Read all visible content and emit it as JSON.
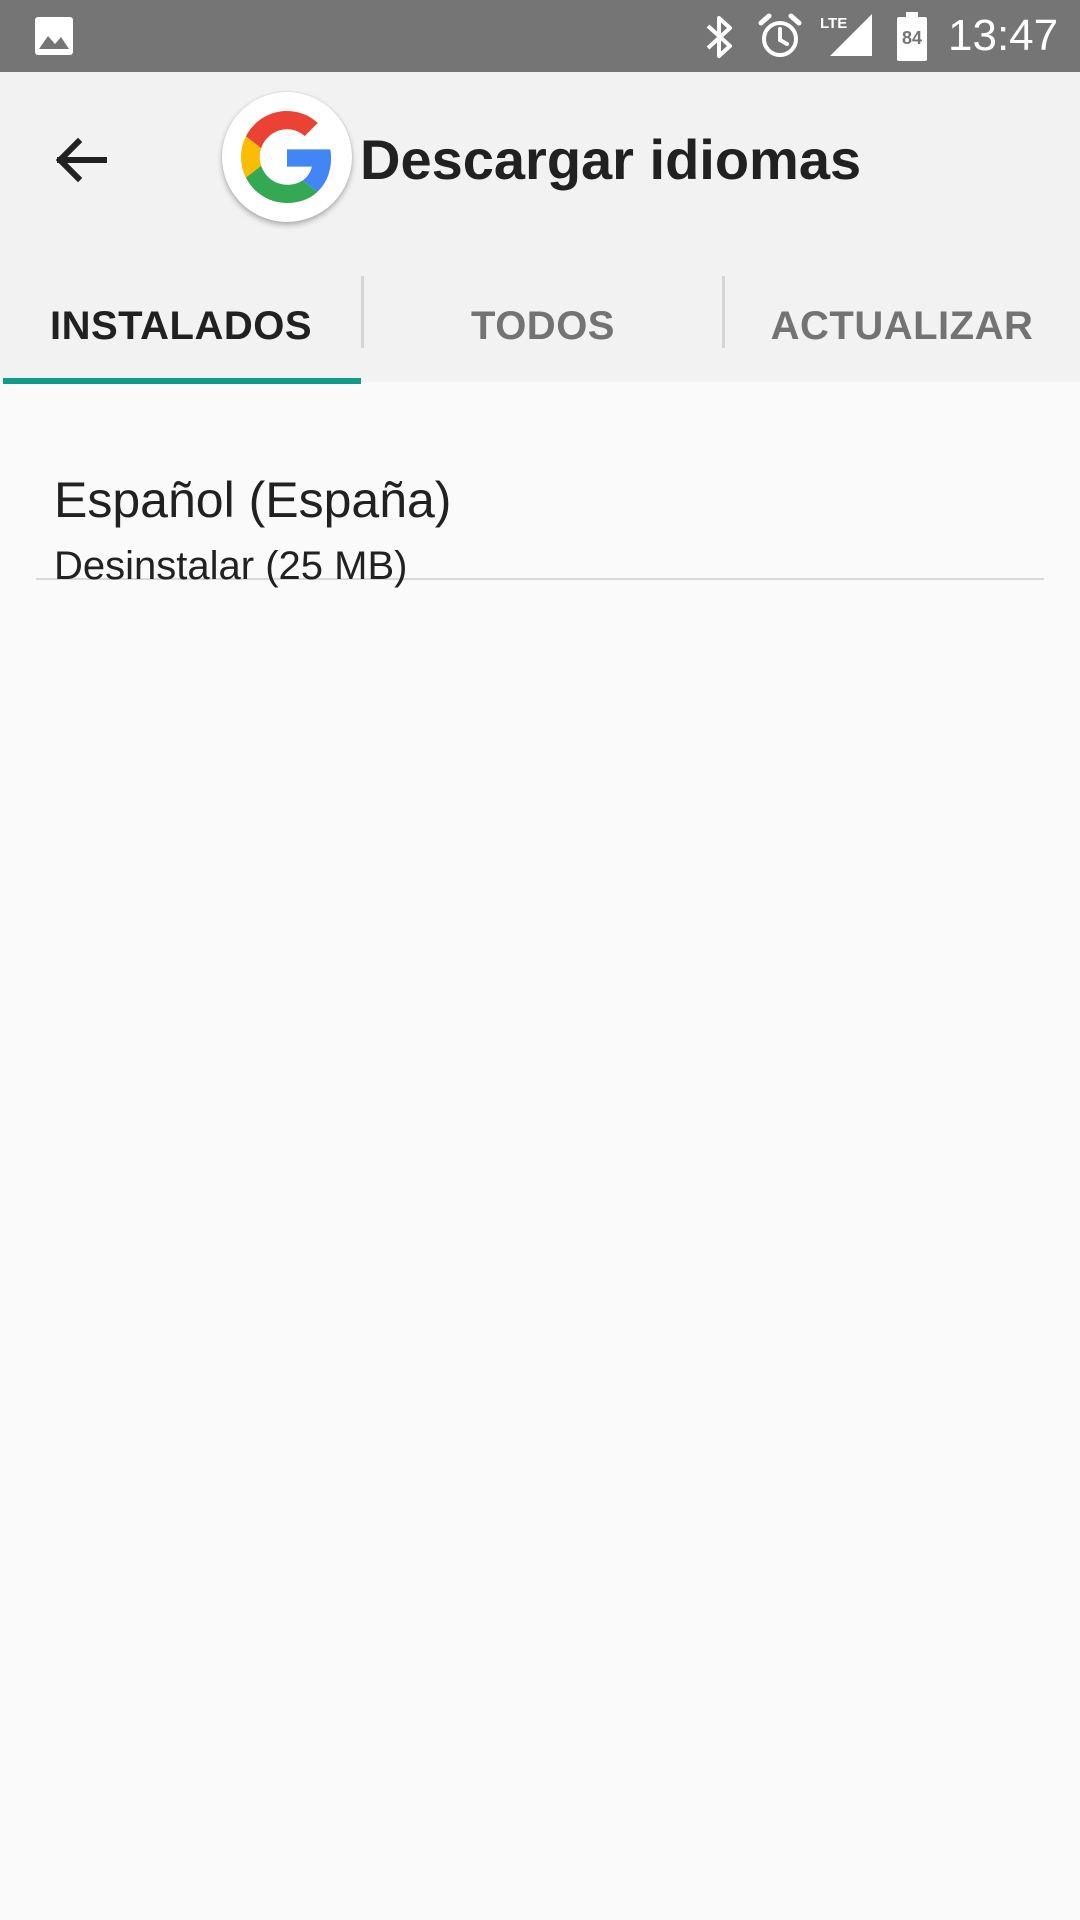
{
  "status_bar": {
    "time": "13:47",
    "battery_level": "84",
    "network": "LTE",
    "icons": [
      "gallery-icon",
      "bluetooth-icon",
      "alarm-icon",
      "lte-signal-icon",
      "battery-icon"
    ]
  },
  "app_bar": {
    "title": "Descargar idiomas",
    "logo": "google-g-logo",
    "back_icon": "arrow-back-icon"
  },
  "tabs": [
    {
      "label": "INSTALADOS",
      "selected": true
    },
    {
      "label": "TODOS",
      "selected": false
    },
    {
      "label": "ACTUALIZAR",
      "selected": false
    }
  ],
  "languages": [
    {
      "name": "Español (España)",
      "action": "Desinstalar (25 MB)"
    }
  ],
  "colors": {
    "status_bar": "#757575",
    "app_bar": "#f2f2f2",
    "tab_indicator": "#109a8a",
    "background": "#fafafa"
  }
}
